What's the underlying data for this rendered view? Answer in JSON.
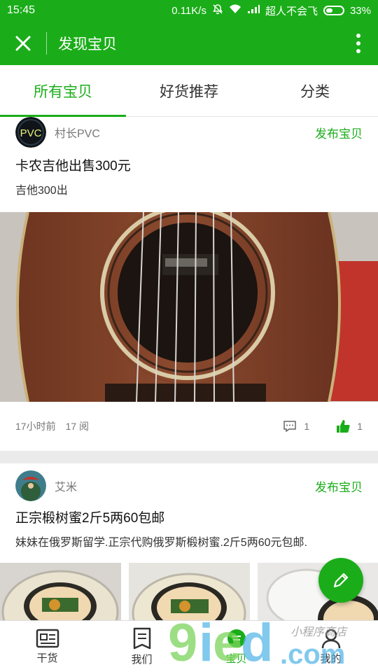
{
  "status_bar": {
    "time": "15:45",
    "network_speed": "0.11K/s",
    "carrier": "超人不会飞",
    "battery": "33%"
  },
  "app_bar": {
    "title": "发现宝贝",
    "close_icon": "close-icon",
    "more_icon": "more-vertical-icon"
  },
  "tabs": [
    {
      "label": "所有宝贝",
      "active": true
    },
    {
      "label": "好货推荐",
      "active": false
    },
    {
      "label": "分类",
      "active": false
    }
  ],
  "posts": [
    {
      "user": "村长PVC",
      "avatar_text": "PVC",
      "publish_label": "发布宝贝",
      "title": "卡农吉他出售300元",
      "desc": "吉他300出",
      "time": "17小时前",
      "views": "17 阅",
      "comments": "1",
      "likes": "1"
    },
    {
      "user": "艾米",
      "publish_label": "发布宝贝",
      "title": "正宗椴树蜜2斤5两60包邮",
      "desc": "妹妹在俄罗斯留学.正宗代购俄罗斯椴树蜜.2斤5两60元包邮."
    }
  ],
  "bottom_nav": [
    {
      "label": "干货",
      "icon": "article-icon"
    },
    {
      "label": "我们",
      "icon": "list-icon"
    },
    {
      "label": "宝贝",
      "icon": "treasure-icon",
      "active": true
    },
    {
      "label": "我的",
      "icon": "person-icon"
    }
  ],
  "fab": {
    "icon": "edit-pencil-icon"
  },
  "watermark": {
    "text": "9ied.com",
    "handwritten": "小程序商店"
  },
  "colors": {
    "accent": "#1aad19"
  }
}
